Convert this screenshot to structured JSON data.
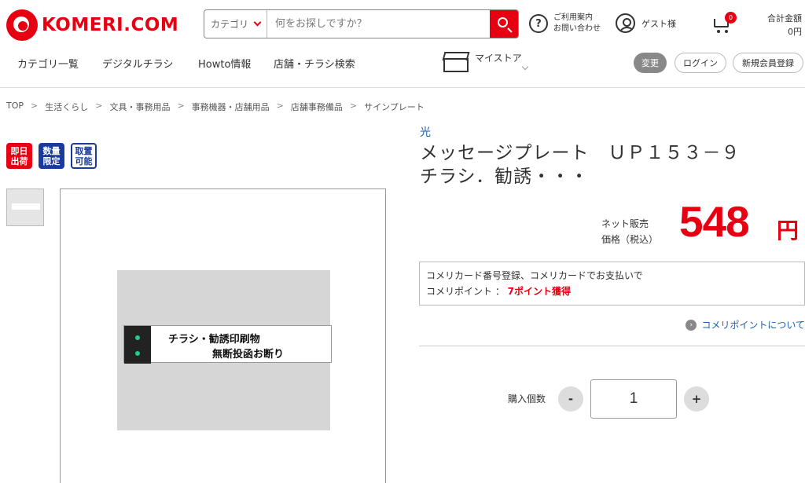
{
  "header": {
    "logo_text": "KOMERI.COM",
    "search": {
      "category_label": "カテゴリ",
      "placeholder": "何をお探しですか？"
    },
    "help": {
      "line1": "ご利用案内",
      "line2": "お問い合わせ",
      "icon": "question-icon"
    },
    "guest_label": "ゲスト様",
    "cart_count": "0",
    "total": {
      "label": "合計金額",
      "value": "0円"
    }
  },
  "nav": {
    "items": [
      "カテゴリ一覧",
      "デジタルチラシ",
      "Howto情報",
      "店舗・チラシ検索"
    ],
    "mystore_label": "マイストア",
    "change_label": "変更",
    "login_label": "ログイン",
    "register_label": "新規会員登録"
  },
  "breadcrumb": [
    "TOP",
    "生活くらし",
    "文具・事務用品",
    "事務機器・店舗用品",
    "店舗事務備品",
    "サインプレート"
  ],
  "badges": [
    {
      "line1": "即日",
      "line2": "出荷",
      "style": "red"
    },
    {
      "line1": "数量",
      "line2": "限定",
      "style": "blue"
    },
    {
      "line1": "取置",
      "line2": "可能",
      "style": "outline"
    }
  ],
  "product": {
    "brand": "光",
    "title_line1": "メッセージプレート　ＵＰ１５３－９",
    "title_line2": "チラシ．勧誘・・・",
    "image_text_line1": "チラシ・勧誘印刷物",
    "image_text_line2": "無断投函お断り",
    "price_label_line1": "ネット販売",
    "price_label_line2": "価格（税込）",
    "price": "548",
    "currency": "円"
  },
  "points": {
    "line1": "コメリカード番号登録、コメリカードでお支払いで",
    "line2_prefix": "コメリポイント ： ",
    "line2_value": "7ポイント獲得",
    "link": "コメリポイントについて"
  },
  "quantity": {
    "label": "購入個数",
    "value": "1",
    "minus": "-",
    "plus": "+"
  },
  "colors": {
    "brand_red": "#e60012",
    "link_blue": "#1a5fb4",
    "badge_blue": "#1a3a9c"
  }
}
